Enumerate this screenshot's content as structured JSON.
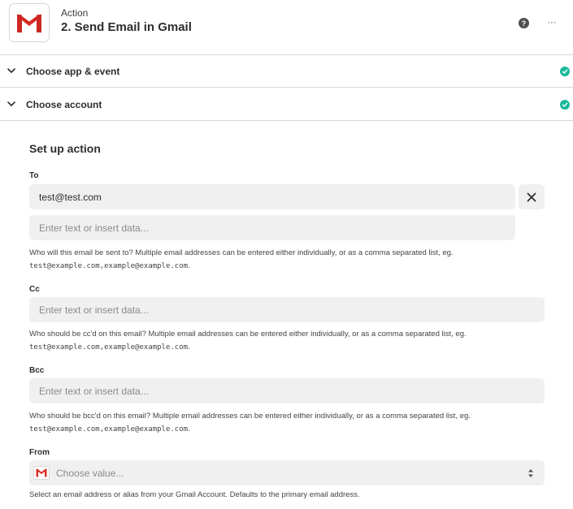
{
  "header": {
    "subtitle": "Action",
    "title": "2. Send Email in Gmail",
    "help_label": "?",
    "more_label": "···"
  },
  "sections": [
    {
      "label": "Choose app & event",
      "status": "complete"
    },
    {
      "label": "Choose account",
      "status": "complete"
    }
  ],
  "setup": {
    "title": "Set up action",
    "to": {
      "label": "To",
      "value": "test@test.com",
      "placeholder": "Enter text or insert data...",
      "help_prefix": "Who will this email be sent to? Multiple email addresses can be entered either individually, or as a comma separated list, eg.",
      "help_example": "test@example.com,example@example.com",
      "help_suffix": "."
    },
    "cc": {
      "label": "Cc",
      "placeholder": "Enter text or insert data...",
      "help_prefix": "Who should be cc'd on this email? Multiple email addresses can be entered either individually, or as a comma separated list, eg.",
      "help_example": "test@example.com,example@example.com",
      "help_suffix": "."
    },
    "bcc": {
      "label": "Bcc",
      "placeholder": "Enter text or insert data...",
      "help_prefix": "Who should be bcc'd on this email? Multiple email addresses can be entered either individually, or as a comma separated list, eg.",
      "help_example": "test@example.com,example@example.com",
      "help_suffix": "."
    },
    "from": {
      "label": "From",
      "placeholder": "Choose value...",
      "help": "Select an email address or alias from your Gmail Account. Defaults to the primary email address."
    }
  },
  "colors": {
    "check": "#1bb89b",
    "gmail_red": "#d93025",
    "input_bg": "#f0f0f0"
  }
}
